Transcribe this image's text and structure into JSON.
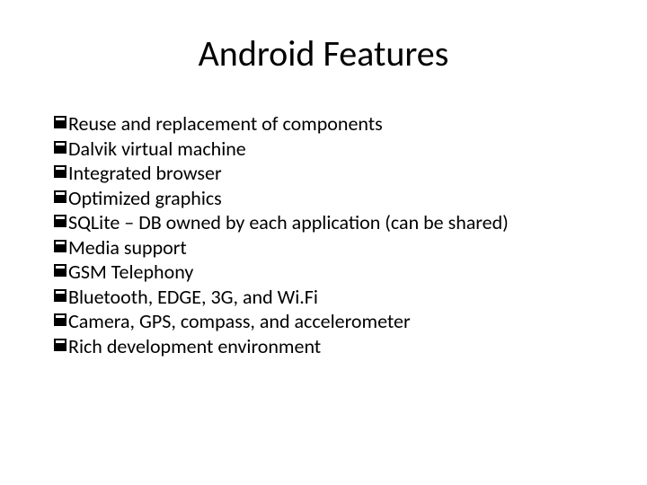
{
  "slide": {
    "title": "Android Features",
    "bullets": [
      "Reuse and replacement of components",
      "Dalvik virtual machine",
      "Integrated browser",
      "Optimized graphics",
      "SQLite – DB owned by each application (can be shared)",
      "Media support",
      "GSM Telephony",
      "Bluetooth, EDGE, 3G, and Wi.Fi",
      "Camera, GPS, compass, and accelerometer",
      "Rich development environment"
    ]
  }
}
